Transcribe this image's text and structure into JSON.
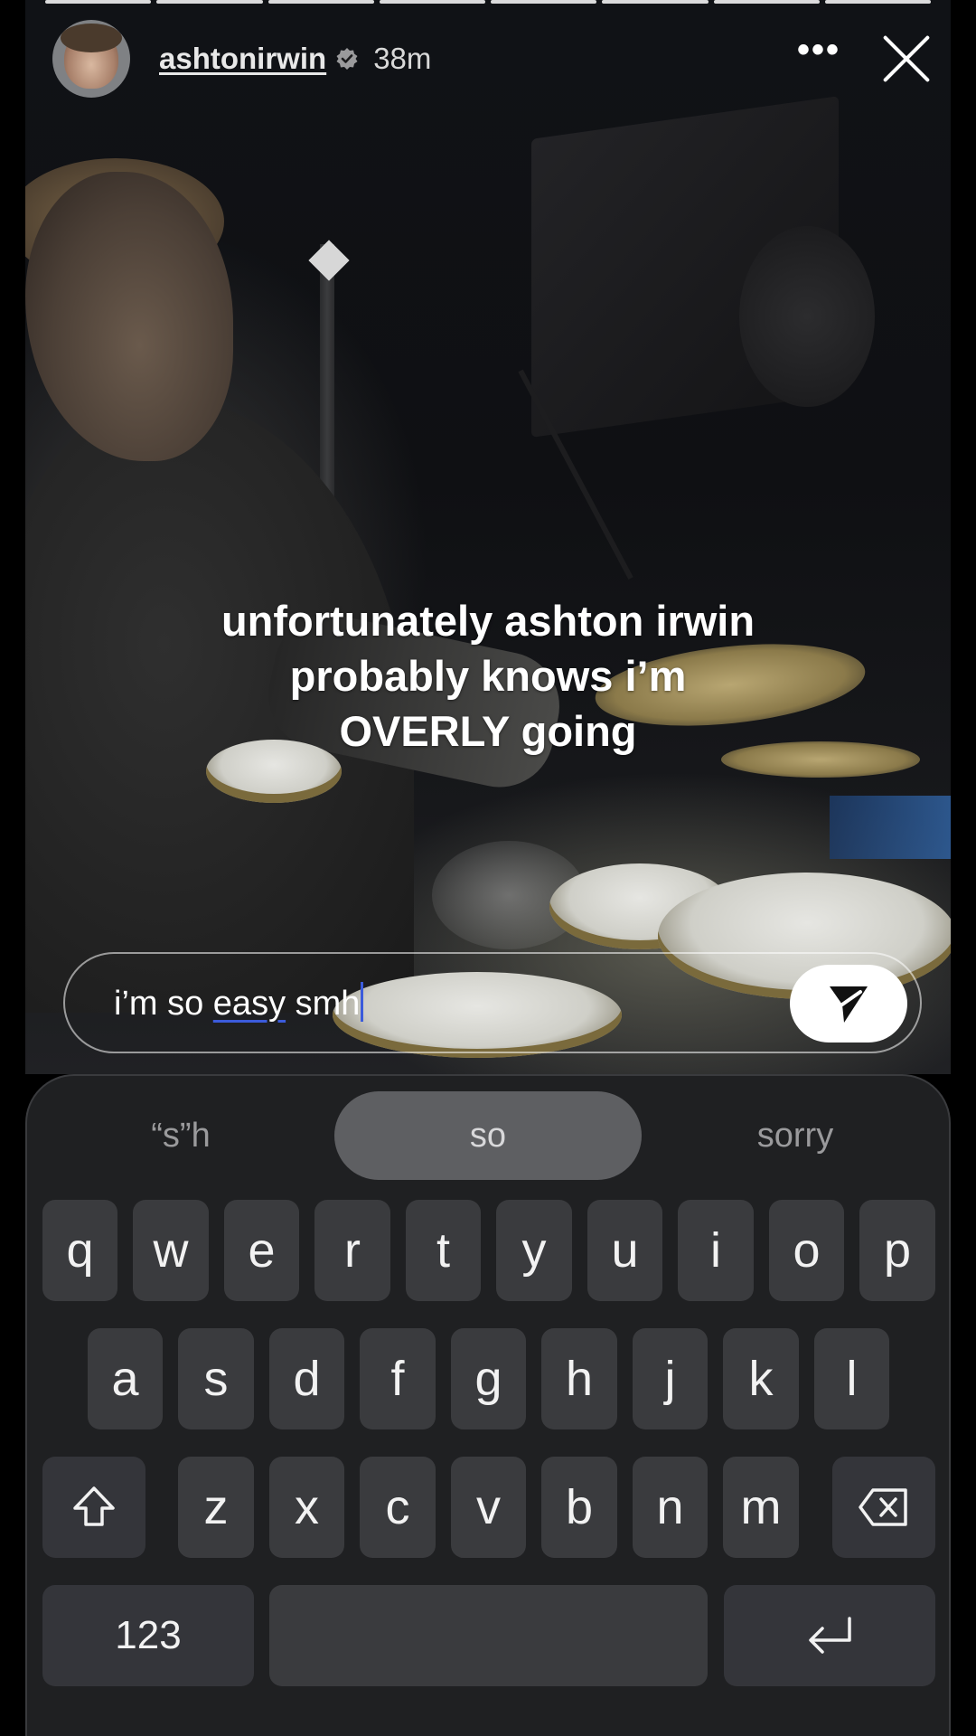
{
  "header": {
    "username": "ashtonirwin",
    "timestamp": "38m",
    "more_icon": "ellipsis-icon",
    "close_icon": "close-icon"
  },
  "story": {
    "progress_segments": 8,
    "caption_lines": [
      "unfortunately ashton irwin",
      "probably knows i’m",
      "OVERLY going"
    ]
  },
  "reply": {
    "text_before": "i’m so ",
    "misspelled_word": "easy",
    "text_after": " smh",
    "send_icon": "send-icon"
  },
  "keyboard": {
    "suggestions": {
      "left": "“s”h",
      "middle": "so",
      "right": "sorry"
    },
    "row1": [
      "q",
      "w",
      "e",
      "r",
      "t",
      "y",
      "u",
      "i",
      "o",
      "p"
    ],
    "row2": [
      "a",
      "s",
      "d",
      "f",
      "g",
      "h",
      "j",
      "k",
      "l"
    ],
    "row3": [
      "z",
      "x",
      "c",
      "v",
      "b",
      "n",
      "m"
    ],
    "numbers_label": "123",
    "shift_icon": "shift-arrow-icon",
    "backspace_icon": "backspace-icon",
    "return_icon": "return-icon"
  }
}
